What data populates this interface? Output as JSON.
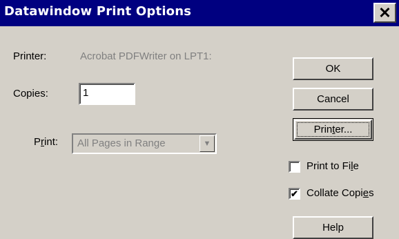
{
  "window": {
    "title": "Datawindow Print Options",
    "close_symbol": "✕"
  },
  "form": {
    "printer_label": "Printer:",
    "printer_value": "Acrobat PDFWriter on LPT1:",
    "copies_label": "Copies:",
    "copies_value": "1",
    "print_label_pre": "P",
    "print_label_accel": "r",
    "print_label_post": "int:",
    "print_range_value": "All Pages in Range",
    "print_range_arrow": "▼"
  },
  "buttons": {
    "ok": "OK",
    "cancel": "Cancel",
    "printer_pre": "Prin",
    "printer_accel": "t",
    "printer_post": "er...",
    "help": "Help"
  },
  "checkboxes": {
    "print_to_file": {
      "pre": "Print to Fi",
      "accel": "l",
      "post": "e",
      "checked": false
    },
    "collate_copies": {
      "pre": "Collate Copi",
      "accel": "e",
      "post": "s",
      "checked": true,
      "check_glyph": "✔"
    }
  }
}
